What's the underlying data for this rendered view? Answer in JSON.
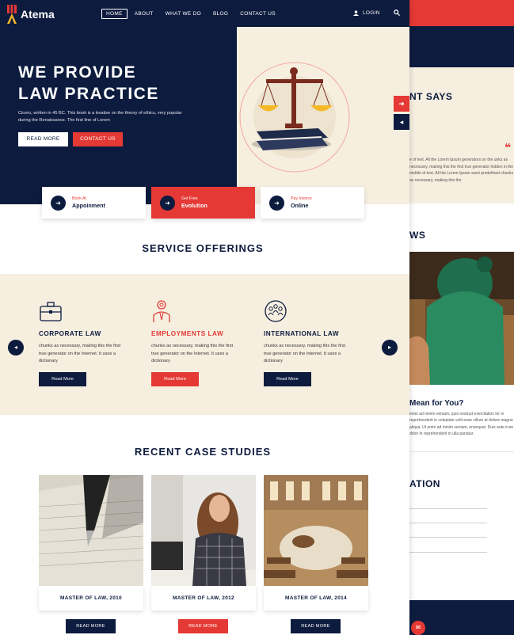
{
  "brand": {
    "name": "Atema"
  },
  "nav": {
    "items": [
      "HOME",
      "ABOUT",
      "WHAT WE DO",
      "BLOG",
      "CONTACT US"
    ],
    "active": "HOME",
    "login": "LOGIN"
  },
  "hero": {
    "title_line1": "WE PROVIDE",
    "title_line2": "LAW PRACTICE",
    "description": "Cicero, written in 45 BC. This book is a treatise on the theory of ethics, very popular during the Renaissance. The first line of Lorem",
    "read_more": "READ MORE",
    "contact": "CONTACT US"
  },
  "action_cards": [
    {
      "small": "Book At",
      "big": "Appoinment"
    },
    {
      "small": "Get Free",
      "big": "Evolution"
    },
    {
      "small": "Pay Invoice",
      "big": "Online"
    }
  ],
  "services": {
    "heading": "SERVICE OFFERINGS",
    "items": [
      {
        "title": "CORPORATE LAW",
        "desc": "chunks as necessary, making this the first true generator on the Internet. It uses a dictionary",
        "button": "Read More"
      },
      {
        "title": "EMPLOYMENTS LAW",
        "desc": "chunks as necessary, making this the first true generator on the Internet. It uses a dictionary",
        "button": "Read More"
      },
      {
        "title": "INTERNATIONAL LAW",
        "desc": "chunks as necessary, making this the first true generator on the Internet. It uses a dictionary",
        "button": "Read More"
      }
    ]
  },
  "cases": {
    "heading": "RECENT CASE STUDIES",
    "items": [
      {
        "caption": "MASTER OF LAW, 2010",
        "button": "READ MORE"
      },
      {
        "caption": "MASTER OF LAW, 2012",
        "button": "READ MORE"
      },
      {
        "caption": "MASTER OF LAW, 2014",
        "button": "READ MORE"
      }
    ]
  },
  "back_page": {
    "testimonial_heading": "NT SAYS",
    "testimonial_text": "e of text. All the Lorem Ipsum generators on the unks as necessary, making this the first true generator hidden in the middle of text. All the Lorem Ipsum ssert predefined chunks as necessary, making this the",
    "news_heading": "WS",
    "question_heading": "Mean for You?",
    "question_text": "enim ad minim veniam, quis nostrud exercitation lor in reprehenderit in voluptate velit esse cillum at dolore magna aliqua. Ut enim ad minim veniam, onsequat. Duis aute irure dolor in reprehenderit in ulla pariatur.",
    "form_heading": "ATION"
  },
  "colors": {
    "navy": "#0d1b3e",
    "red": "#e53935",
    "cream": "#f6efe0"
  }
}
